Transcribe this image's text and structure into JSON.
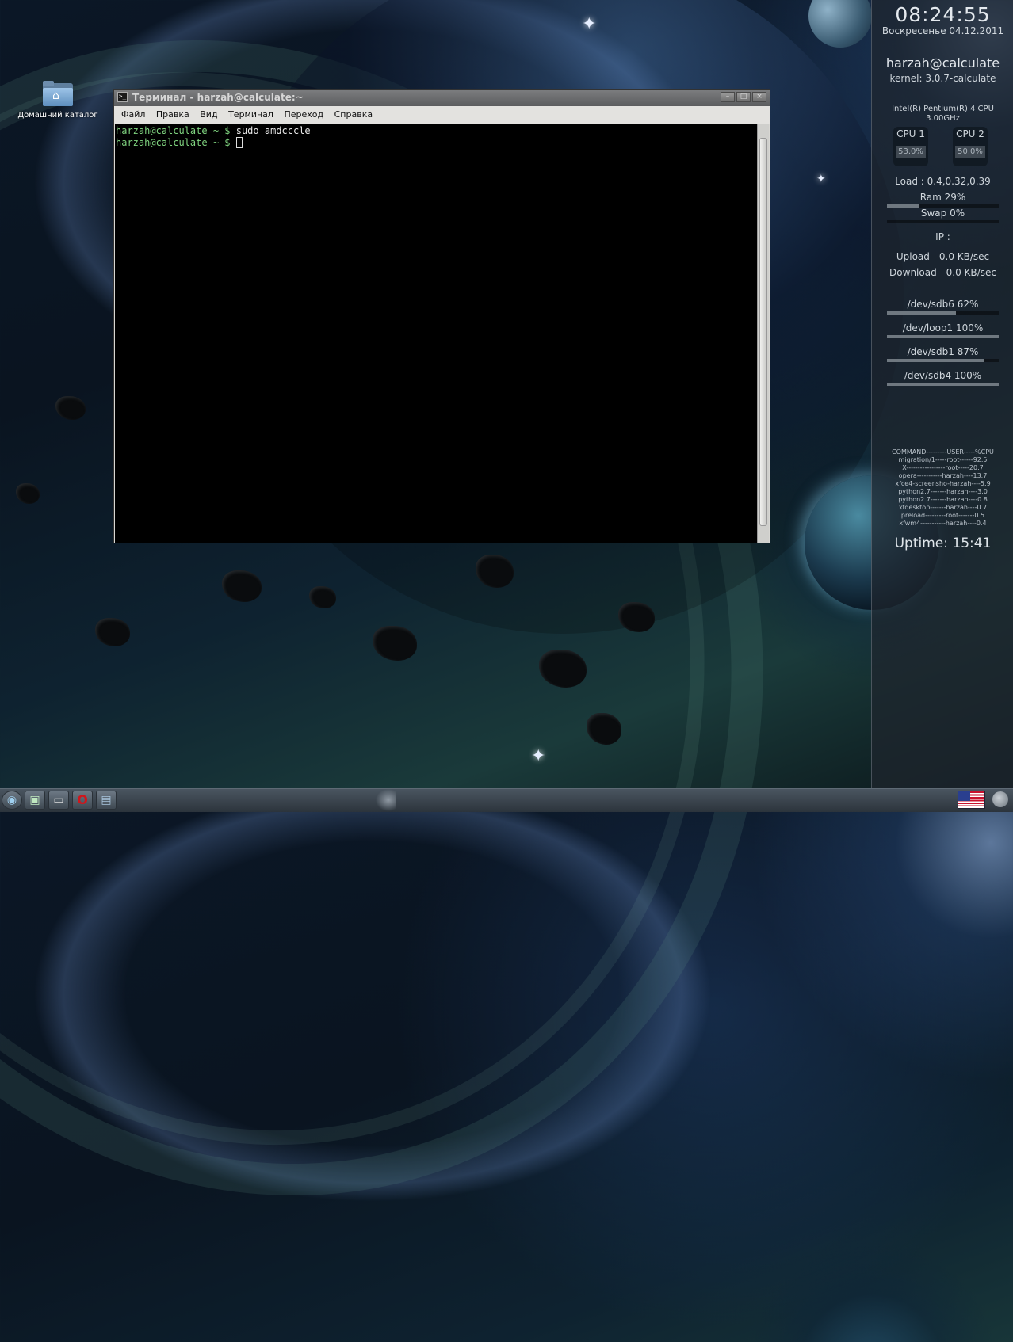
{
  "desktop": {
    "home_icon_label": "Домашний каталог"
  },
  "terminal": {
    "title": "Терминал - harzah@calculate:~",
    "menu": [
      {
        "label": "Файл"
      },
      {
        "label": "Правка"
      },
      {
        "label": "Вид"
      },
      {
        "label": "Терминал"
      },
      {
        "label": "Переход"
      },
      {
        "label": "Справка"
      }
    ],
    "lines": [
      {
        "prompt": "harzah@calculate ~ $",
        "command": "sudo amdcccle"
      },
      {
        "prompt": "harzah@calculate ~ $",
        "command": ""
      }
    ],
    "buttons": {
      "minimize": "–",
      "maximize": "□",
      "close": "×"
    }
  },
  "conky": {
    "time": "08:24:55",
    "date": "Воскресенье 04.12.2011",
    "user": "harzah@calculate",
    "kernel": "kernel: 3.0.7-calculate",
    "cpu_model": "Intel(R) Pentium(R) 4 CPU",
    "cpu_freq": "3.00GHz",
    "cpus": [
      {
        "label": "CPU 1",
        "value": "53.0%"
      },
      {
        "label": "CPU 2",
        "value": "50.0%"
      }
    ],
    "load": "Load : 0.4,0.32,0.39",
    "ram": "Ram 29%",
    "ram_fraction": 0.29,
    "swap": "Swap 0%",
    "swap_fraction": 0.0,
    "ip": "IP :",
    "upload": "Upload - 0.0 KB/sec",
    "download": "Download - 0.0 KB/sec",
    "disks": [
      {
        "label": "/dev/sdb6 62%",
        "fraction": 0.62
      },
      {
        "label": "/dev/loop1 100%",
        "fraction": 1.0
      },
      {
        "label": "/dev/sdb1 87%",
        "fraction": 0.87
      },
      {
        "label": "/dev/sdb4 100%",
        "fraction": 1.0
      }
    ],
    "processes": [
      "COMMAND---------USER-----%CPU",
      "migration/1-----root------92.5",
      "X-----------------root-----20.7",
      "opera-----------harzah----13.7",
      "xfce4-screensho-harzah----5.9",
      "python2.7-------harzah----3.0",
      "python2.7-------harzah----0.8",
      "xfdesktop-------harzah----0.7",
      "preload---------root-------0.5",
      "xfwm4-----------harzah----0.4"
    ],
    "uptime": "Uptime: 15:41"
  },
  "taskbar": {
    "items": [
      {
        "name": "menu-icon",
        "glyph": "◉"
      },
      {
        "name": "terminal-icon",
        "glyph": "▣"
      },
      {
        "name": "window-icon",
        "glyph": "▭"
      },
      {
        "name": "opera-icon",
        "glyph": "O"
      },
      {
        "name": "file-manager-icon",
        "glyph": "▤"
      }
    ]
  },
  "colors": {
    "prompt": "#7fd37f",
    "terminal_bg": "#000000",
    "opera_red": "#d0161c"
  }
}
